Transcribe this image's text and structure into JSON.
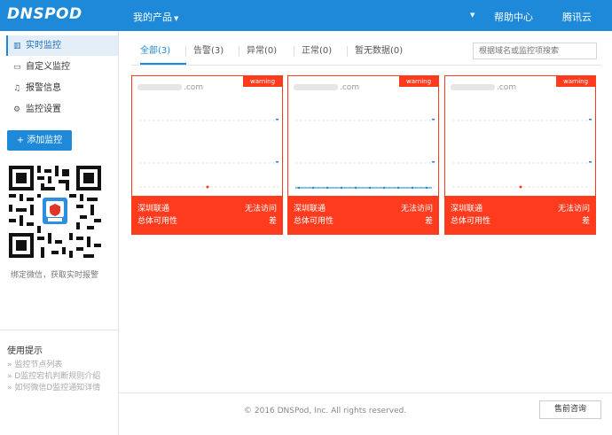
{
  "header": {
    "logo": "DNSPOD",
    "products": "我的产品",
    "help": "帮助中心",
    "tencent": "腾讯云"
  },
  "sidebar": {
    "items": [
      {
        "label": "实时监控",
        "icon": "chart-icon"
      },
      {
        "label": "自定义监控",
        "icon": "monitor-icon"
      },
      {
        "label": "报警信息",
        "icon": "bell-icon"
      },
      {
        "label": "监控设置",
        "icon": "gear-icon"
      }
    ],
    "add_button": "添加监控",
    "qr_caption": "绑定微信，获取实时报警",
    "tips_title": "使用提示",
    "tips": [
      "» 监控节点列表",
      "» D监控宕机判断规则介绍",
      "» 如何微信D监控通知详情"
    ]
  },
  "tabs": [
    {
      "label": "全部(3)",
      "active": true
    },
    {
      "label": "告警(3)",
      "active": false
    },
    {
      "label": "异常(0)",
      "active": false
    },
    {
      "label": "正常(0)",
      "active": false
    },
    {
      "label": "暂无数据(0)",
      "active": false
    }
  ],
  "search": {
    "placeholder": "根据域名或监控项搜索"
  },
  "cards": [
    {
      "domain_suffix": ".com",
      "status": "warning",
      "line1_left": "深圳联通",
      "line1_right": "无法访问",
      "line2_left": "总体可用性",
      "line2_right": "差",
      "series": "single-point"
    },
    {
      "domain_suffix": ".com",
      "status": "warning",
      "line1_left": "深圳联通",
      "line1_right": "无法访问",
      "line2_left": "总体可用性",
      "line2_right": "差",
      "series": "flat-line"
    },
    {
      "domain_suffix": ".com",
      "status": "warning",
      "line1_left": "深圳联通",
      "line1_right": "无法访问",
      "line2_left": "总体可用性",
      "line2_right": "差",
      "series": "single-point"
    }
  ],
  "footer": {
    "copyright": "© 2016 DNSPod, Inc. All rights reserved.",
    "consult": "售前咨询"
  },
  "colors": {
    "accent": "#1e88d9",
    "warning": "#ff3b1e"
  }
}
